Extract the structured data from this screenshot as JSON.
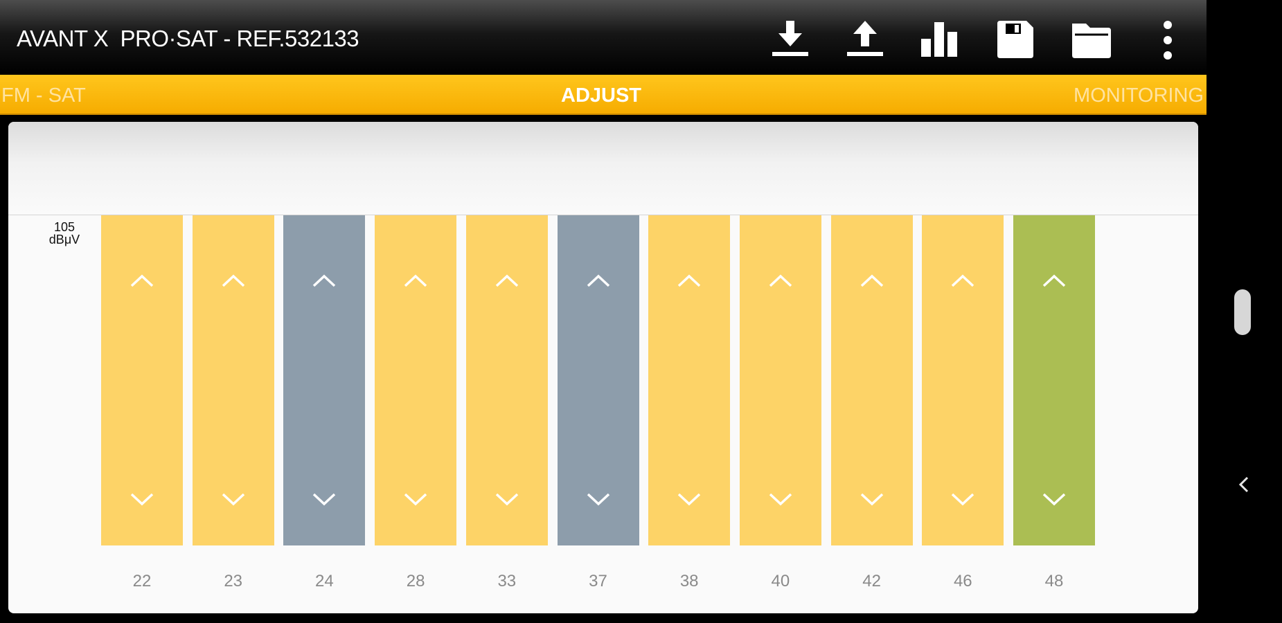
{
  "app": {
    "title": "AVANT X  PRO·SAT - REF.532133"
  },
  "toolbar": {
    "actions": [
      {
        "name": "download-icon"
      },
      {
        "name": "upload-icon"
      },
      {
        "name": "bar-chart-icon"
      },
      {
        "name": "save-icon"
      },
      {
        "name": "folder-icon"
      },
      {
        "name": "more-vertical-icon"
      }
    ]
  },
  "tabs": [
    {
      "label": "FM - SAT",
      "active": false
    },
    {
      "label": "ADJUST",
      "active": true
    },
    {
      "label": "MONITORING",
      "active": false
    }
  ],
  "adjust": {
    "level": {
      "value": "105",
      "unit": "dBμV"
    },
    "channels": [
      {
        "label": "22",
        "color": "#FDD367"
      },
      {
        "label": "23",
        "color": "#FDD367"
      },
      {
        "label": "24",
        "color": "#8D9DAB"
      },
      {
        "label": "28",
        "color": "#FDD367"
      },
      {
        "label": "33",
        "color": "#FDD367"
      },
      {
        "label": "37",
        "color": "#8D9DAB"
      },
      {
        "label": "38",
        "color": "#FDD367"
      },
      {
        "label": "40",
        "color": "#FDD367"
      },
      {
        "label": "42",
        "color": "#FDD367"
      },
      {
        "label": "46",
        "color": "#FDD367"
      },
      {
        "label": "48",
        "color": "#ABBE53"
      }
    ]
  },
  "colors": {
    "accent": "#F7AE00",
    "bar_default": "#FDD367",
    "bar_muted": "#8D9DAB",
    "bar_selected": "#ABBE53"
  },
  "system_nav": {
    "back_icon": "chevron-left-icon",
    "scroll_handle": "scroll-handle"
  }
}
